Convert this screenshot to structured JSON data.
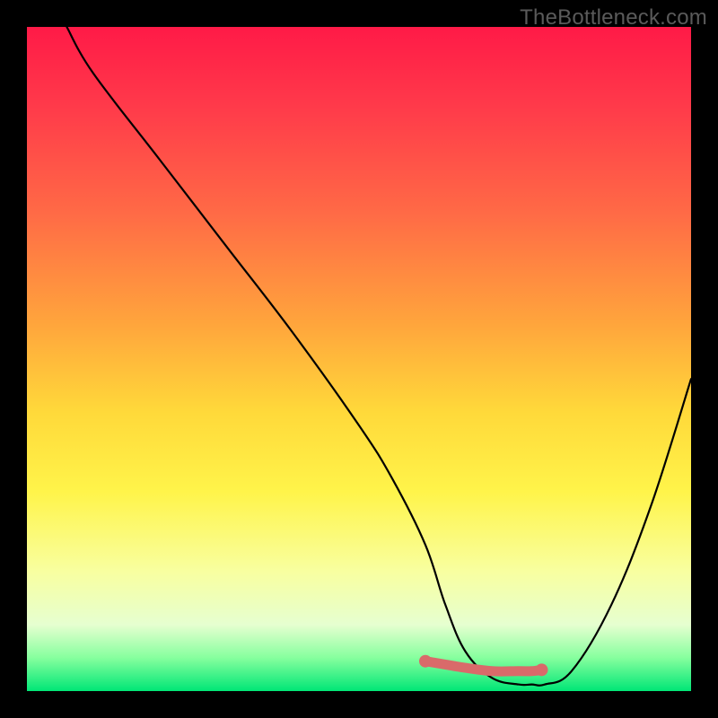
{
  "watermark": "TheBottleneck.com",
  "chart_data": {
    "type": "line",
    "title": "",
    "xlabel": "",
    "ylabel": "",
    "xlim": [
      0,
      100
    ],
    "ylim": [
      0,
      100
    ],
    "series": [
      {
        "name": "curve",
        "x": [
          6,
          10,
          20,
          30,
          40,
          50,
          55,
          60,
          63,
          66,
          70,
          74,
          76,
          78,
          82,
          88,
          94,
          100
        ],
        "values": [
          100,
          93,
          80,
          67,
          54,
          40,
          32,
          22,
          13,
          6,
          2,
          1,
          1,
          1,
          3,
          13,
          28,
          47
        ]
      }
    ],
    "highlight": {
      "name": "flat-segment",
      "x": [
        60,
        63,
        66,
        70,
        74,
        76,
        77.5
      ],
      "values": [
        4.5,
        4,
        3.5,
        3,
        3,
        3,
        3.2
      ],
      "dot": {
        "x": 77.5,
        "y": 3.2
      },
      "start_dot": {
        "x": 60,
        "y": 4.5
      }
    },
    "colors": {
      "curve": "#000000",
      "highlight": "#d96a6a"
    }
  }
}
